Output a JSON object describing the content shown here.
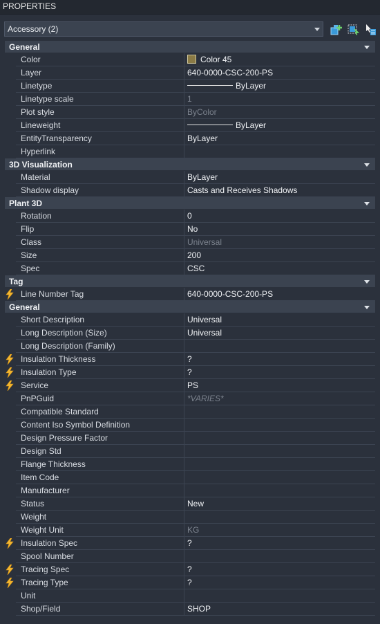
{
  "panel": {
    "title": "PROPERTIES"
  },
  "selector": {
    "value": "Accessory (2)"
  },
  "toolbar_icons": [
    "add-to-selection-icon",
    "quick-select-icon",
    "select-objects-icon"
  ],
  "sections": [
    {
      "title": "General",
      "rows": [
        {
          "name": "Color",
          "value": "Color 45",
          "kind": "color",
          "swatch": "#8a7a45"
        },
        {
          "name": "Layer",
          "value": "640-0000-CSC-200-PS"
        },
        {
          "name": "Linetype",
          "value": "ByLayer",
          "kind": "line"
        },
        {
          "name": "Linetype scale",
          "value": "1",
          "kind": "dim"
        },
        {
          "name": "Plot style",
          "value": "ByColor",
          "kind": "dim"
        },
        {
          "name": "Lineweight",
          "value": "ByLayer",
          "kind": "line"
        },
        {
          "name": "EntityTransparency",
          "value": "ByLayer"
        },
        {
          "name": "Hyperlink",
          "value": ""
        }
      ]
    },
    {
      "title": "3D Visualization",
      "rows": [
        {
          "name": "Material",
          "value": "ByLayer"
        },
        {
          "name": "Shadow display",
          "value": "Casts and Receives Shadows"
        }
      ]
    },
    {
      "title": "Plant 3D",
      "rows": [
        {
          "name": "Rotation",
          "value": "0"
        },
        {
          "name": "Flip",
          "value": "No"
        },
        {
          "name": "Class",
          "value": "Universal",
          "kind": "dim"
        },
        {
          "name": "Size",
          "value": "200"
        },
        {
          "name": "Spec",
          "value": "CSC"
        }
      ]
    },
    {
      "title": "Tag",
      "rows": [
        {
          "name": "Line Number Tag",
          "value": "640-0000-CSC-200-PS",
          "bolt": true
        }
      ]
    },
    {
      "title": "General",
      "rows": [
        {
          "name": "Short Description",
          "value": "Universal"
        },
        {
          "name": "Long Description (Size)",
          "value": "Universal"
        },
        {
          "name": "Long Description (Family)",
          "value": ""
        },
        {
          "name": "Insulation Thickness",
          "value": "?",
          "bolt": true
        },
        {
          "name": "Insulation Type",
          "value": "?",
          "bolt": true
        },
        {
          "name": "Service",
          "value": "PS",
          "bolt": true
        },
        {
          "name": "PnPGuid",
          "value": "*VARIES*",
          "kind": "ital"
        },
        {
          "name": "Compatible Standard",
          "value": ""
        },
        {
          "name": "Content Iso Symbol Definition",
          "value": ""
        },
        {
          "name": "Design Pressure Factor",
          "value": ""
        },
        {
          "name": "Design Std",
          "value": ""
        },
        {
          "name": "Flange Thickness",
          "value": ""
        },
        {
          "name": "Item Code",
          "value": ""
        },
        {
          "name": "Manufacturer",
          "value": ""
        },
        {
          "name": "Status",
          "value": "New"
        },
        {
          "name": "Weight",
          "value": ""
        },
        {
          "name": "Weight Unit",
          "value": "KG",
          "kind": "dim"
        },
        {
          "name": "Insulation Spec",
          "value": "?",
          "bolt": true
        },
        {
          "name": "Spool Number",
          "value": ""
        },
        {
          "name": "Tracing Spec",
          "value": "?",
          "bolt": true
        },
        {
          "name": "Tracing Type",
          "value": "?",
          "bolt": true
        },
        {
          "name": "Unit",
          "value": ""
        },
        {
          "name": "Shop/Field",
          "value": "SHOP"
        }
      ]
    }
  ]
}
